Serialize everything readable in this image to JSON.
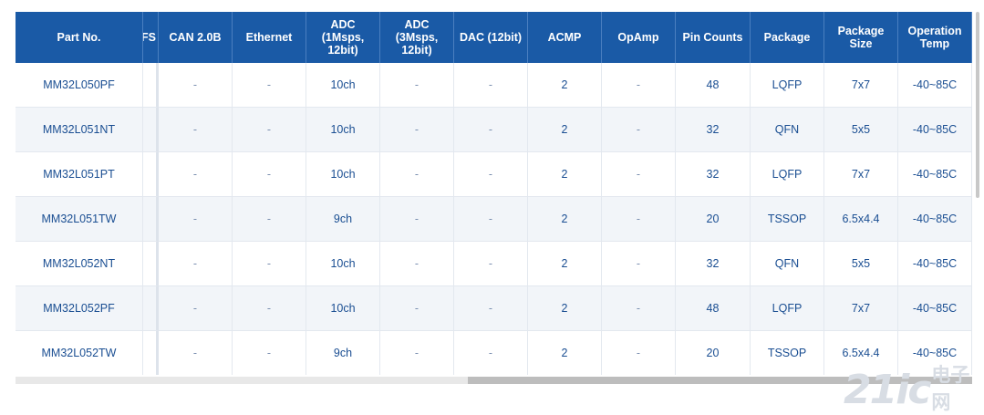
{
  "table": {
    "headers": [
      "Part No.",
      "FS",
      "CAN 2.0B",
      "Ethernet",
      "ADC\n(1Msps,\n12bit)",
      "ADC\n(3Msps,\n12bit)",
      "DAC (12bit)",
      "ACMP",
      "OpAmp",
      "Pin Counts",
      "Package",
      "Package\nSize",
      "Operation\nTemp"
    ],
    "rows": [
      [
        "MM32L050PF",
        "",
        "-",
        "-",
        "10ch",
        "-",
        "-",
        "2",
        "-",
        "48",
        "LQFP",
        "7x7",
        "-40~85C"
      ],
      [
        "MM32L051NT",
        "",
        "-",
        "-",
        "10ch",
        "-",
        "-",
        "2",
        "-",
        "32",
        "QFN",
        "5x5",
        "-40~85C"
      ],
      [
        "MM32L051PT",
        "",
        "-",
        "-",
        "10ch",
        "-",
        "-",
        "2",
        "-",
        "32",
        "LQFP",
        "7x7",
        "-40~85C"
      ],
      [
        "MM32L051TW",
        "",
        "-",
        "-",
        "9ch",
        "-",
        "-",
        "2",
        "-",
        "20",
        "TSSOP",
        "6.5x4.4",
        "-40~85C"
      ],
      [
        "MM32L052NT",
        "",
        "-",
        "-",
        "10ch",
        "-",
        "-",
        "2",
        "-",
        "32",
        "QFN",
        "5x5",
        "-40~85C"
      ],
      [
        "MM32L052PF",
        "",
        "-",
        "-",
        "10ch",
        "-",
        "-",
        "2",
        "-",
        "48",
        "LQFP",
        "7x7",
        "-40~85C"
      ],
      [
        "MM32L052TW",
        "",
        "-",
        "-",
        "9ch",
        "-",
        "-",
        "2",
        "-",
        "20",
        "TSSOP",
        "6.5x4.4",
        "-40~85C"
      ]
    ]
  },
  "watermark": {
    "main": "21ic",
    "sub": "电子网"
  },
  "colors": {
    "header_bg": "#1a5aa6",
    "header_text": "#ffffff",
    "cell_text": "#1a4e92",
    "row_alt": "#f2f5f9"
  }
}
